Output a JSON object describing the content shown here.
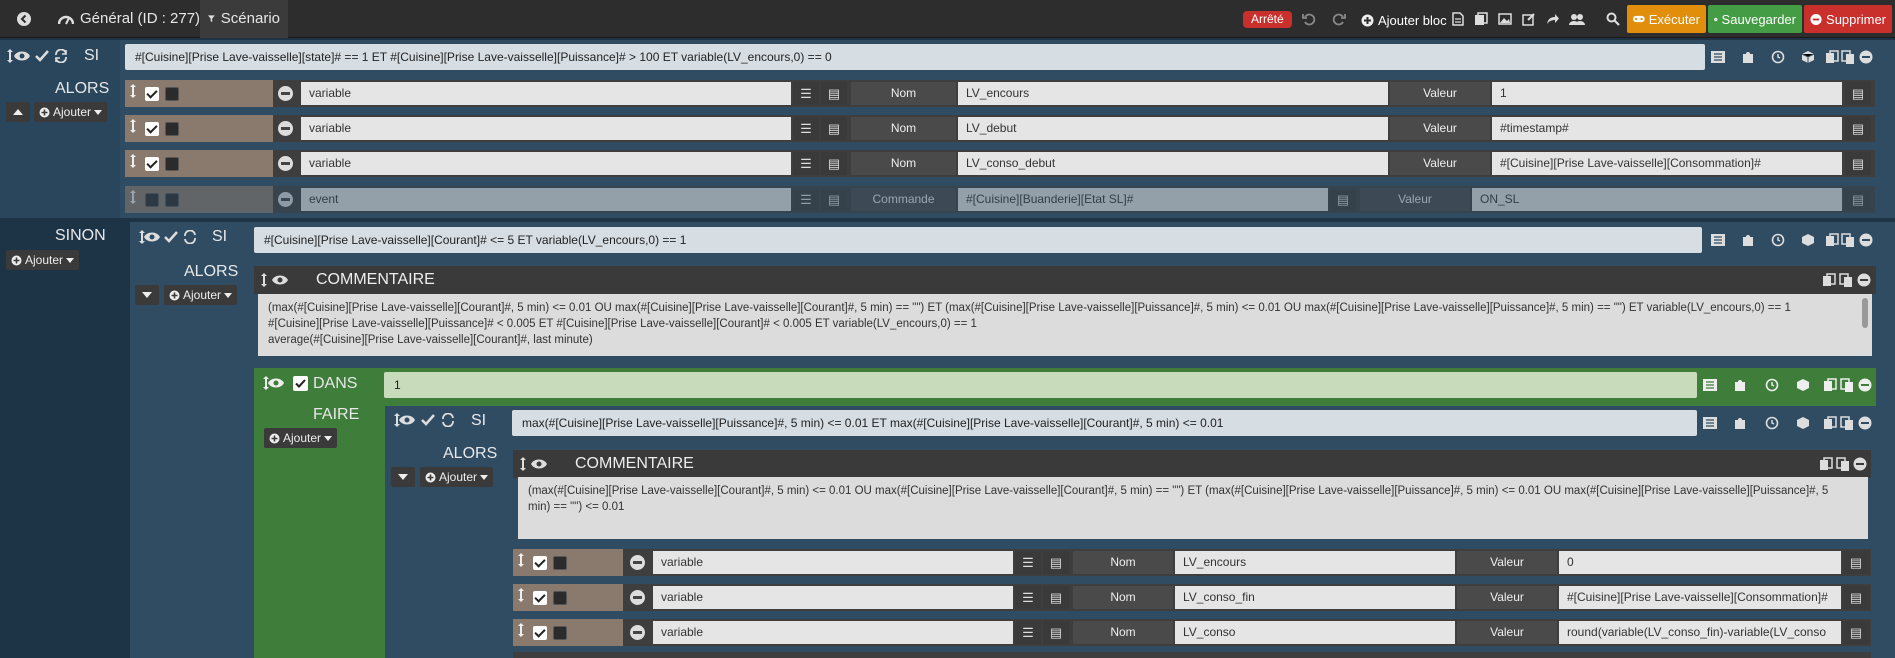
{
  "topbar": {
    "tab_general": "Général (ID : 277)",
    "tab_scenario": "Scénario",
    "status_badge": "Arrêté",
    "add_block": "Ajouter bloc",
    "execute": "Exécuter",
    "save": "Sauvegarder",
    "delete": "Supprimer",
    "colors": {
      "execute": "#e08e0b",
      "save": "#449d44",
      "delete": "#c9302c",
      "stopped": "#c9302c"
    }
  },
  "block1": {
    "si_label": "SI",
    "condition": "#[Cuisine][Prise Lave-vaisselle][state]# == 1 ET #[Cuisine][Prise Lave-vaisselle][Puissance]# > 100 ET variable(LV_encours,0) == 0",
    "alors_label": "ALORS",
    "ajouter": "Ajouter",
    "actions": [
      {
        "type": "variable",
        "name_label": "Nom",
        "name": "LV_encours",
        "value_label": "Valeur",
        "value": "1"
      },
      {
        "type": "variable",
        "name_label": "Nom",
        "name": "LV_debut",
        "value_label": "Valeur",
        "value": "#timestamp#"
      },
      {
        "type": "variable",
        "name_label": "Nom",
        "name": "LV_conso_debut",
        "value_label": "Valeur",
        "value": "#[Cuisine][Prise Lave-vaisselle][Consommation]#"
      },
      {
        "type": "event",
        "cmd_label": "Commande",
        "cmd": "#[Cuisine][Buanderie][Etat SL]#",
        "value_label": "Valeur",
        "value": "ON_SL"
      }
    ],
    "sinon_label": "SINON",
    "sinon_ajouter": "Ajouter"
  },
  "block2": {
    "si_label": "SI",
    "condition": "#[Cuisine][Prise Lave-vaisselle][Courant]# <= 5 ET variable(LV_encours,0) == 1",
    "alors_label": "ALORS",
    "ajouter": "Ajouter",
    "comment_title": "COMMENTAIRE",
    "comment_lines": [
      "(max(#[Cuisine][Prise Lave-vaisselle][Courant]#, 5 min) <= 0.01 OU max(#[Cuisine][Prise Lave-vaisselle][Courant]#, 5 min) == \"\") ET (max(#[Cuisine][Prise Lave-vaisselle][Puissance]#, 5 min) <= 0.01 OU max(#[Cuisine][Prise Lave-vaisselle][Puissance]#, 5 min) == \"\") ET variable(LV_encours,0) == 1",
      "#[Cuisine][Prise Lave-vaisselle][Puissance]# < 0.005 ET #[Cuisine][Prise Lave-vaisselle][Courant]#  < 0.005 ET variable(LV_encours,0) == 1",
      "average(#[Cuisine][Prise Lave-vaisselle][Courant]#, last minute)"
    ]
  },
  "block3": {
    "dans_label": "DANS",
    "dans_value": "1",
    "faire_label": "FAIRE",
    "ajouter": "Ajouter"
  },
  "block4": {
    "si_label": "SI",
    "condition": "max(#[Cuisine][Prise Lave-vaisselle][Puissance]#, 5 min) <= 0.01 ET max(#[Cuisine][Prise Lave-vaisselle][Courant]#, 5 min) <= 0.01",
    "alors_label": "ALORS",
    "ajouter": "Ajouter",
    "comment_title": "COMMENTAIRE",
    "comment_lines": [
      "(max(#[Cuisine][Prise Lave-vaisselle][Courant]#, 5 min) <= 0.01 OU max(#[Cuisine][Prise Lave-vaisselle][Courant]#, 5 min) == \"\") ET (max(#[Cuisine][Prise Lave-vaisselle][Puissance]#, 5 min) <= 0.01 OU max(#[Cuisine][Prise Lave-vaisselle][Puissance]#, 5",
      "min) == \"\") <= 0.01"
    ],
    "actions": [
      {
        "type": "variable",
        "name_label": "Nom",
        "name": "LV_encours",
        "value_label": "Valeur",
        "value": "0"
      },
      {
        "type": "variable",
        "name_label": "Nom",
        "name": "LV_conso_fin",
        "value_label": "Valeur",
        "value": "#[Cuisine][Prise Lave-vaisselle][Consommation]#"
      },
      {
        "type": "variable",
        "name_label": "Nom",
        "name": "LV_conso",
        "value_label": "Valeur",
        "value": "round(variable(LV_conso_fin)-variable(LV_conso"
      }
    ]
  }
}
